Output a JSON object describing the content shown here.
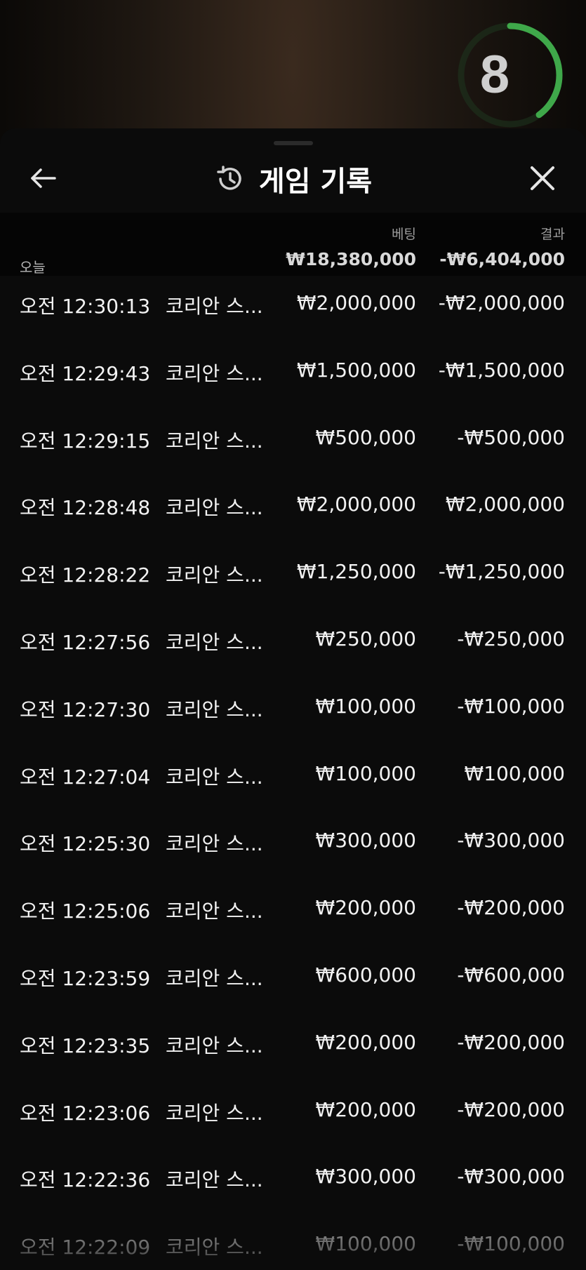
{
  "timer": {
    "value": "8",
    "fraction_remaining": 0.4,
    "ring_color": "#3fa84a"
  },
  "header": {
    "title": "게임 기록",
    "back_icon": "arrow-left-icon",
    "history_icon": "history-icon",
    "close_icon": "close-icon"
  },
  "summary": {
    "bet_label": "베팅",
    "result_label": "결과",
    "period_label": "오늘",
    "bet_total": "₩18,380,000",
    "result_total": "-₩6,404,000"
  },
  "records": [
    {
      "time": "오전 12:30:13",
      "game": "코리안 스...",
      "bet": "₩2,000,000",
      "result": "-₩2,000,000"
    },
    {
      "time": "오전 12:29:43",
      "game": "코리안 스...",
      "bet": "₩1,500,000",
      "result": "-₩1,500,000"
    },
    {
      "time": "오전 12:29:15",
      "game": "코리안 스...",
      "bet": "₩500,000",
      "result": "-₩500,000"
    },
    {
      "time": "오전 12:28:48",
      "game": "코리안 스...",
      "bet": "₩2,000,000",
      "result": "₩2,000,000"
    },
    {
      "time": "오전 12:28:22",
      "game": "코리안 스...",
      "bet": "₩1,250,000",
      "result": "-₩1,250,000"
    },
    {
      "time": "오전 12:27:56",
      "game": "코리안 스...",
      "bet": "₩250,000",
      "result": "-₩250,000"
    },
    {
      "time": "오전 12:27:30",
      "game": "코리안 스...",
      "bet": "₩100,000",
      "result": "-₩100,000"
    },
    {
      "time": "오전 12:27:04",
      "game": "코리안 스...",
      "bet": "₩100,000",
      "result": "₩100,000"
    },
    {
      "time": "오전 12:25:30",
      "game": "코리안 스...",
      "bet": "₩300,000",
      "result": "-₩300,000"
    },
    {
      "time": "오전 12:25:06",
      "game": "코리안 스...",
      "bet": "₩200,000",
      "result": "-₩200,000"
    },
    {
      "time": "오전 12:23:59",
      "game": "코리안 스...",
      "bet": "₩600,000",
      "result": "-₩600,000"
    },
    {
      "time": "오전 12:23:35",
      "game": "코리안 스...",
      "bet": "₩200,000",
      "result": "-₩200,000"
    },
    {
      "time": "오전 12:23:06",
      "game": "코리안 스...",
      "bet": "₩200,000",
      "result": "-₩200,000"
    },
    {
      "time": "오전 12:22:36",
      "game": "코리안 스...",
      "bet": "₩300,000",
      "result": "-₩300,000"
    },
    {
      "time": "오전 12:22:09",
      "game": "코리안 스...",
      "bet": "₩100,000",
      "result": "-₩100,000"
    }
  ]
}
